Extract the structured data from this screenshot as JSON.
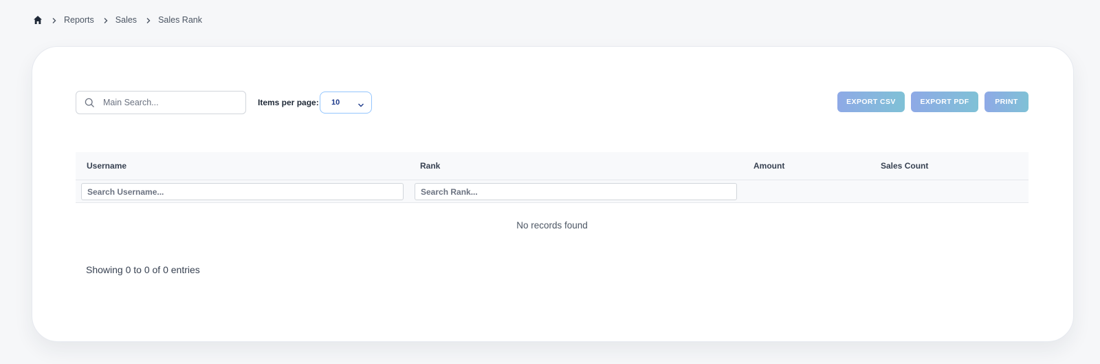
{
  "breadcrumb": {
    "home_icon": "home-icon",
    "items": [
      "Reports",
      "Sales",
      "Sales Rank"
    ]
  },
  "toolbar": {
    "search_placeholder": "Main Search...",
    "items_per_page_label": "Items per page:",
    "items_per_page_value": "10",
    "export_csv": "EXPORT CSV",
    "export_pdf": "EXPORT PDF",
    "print": "PRINT"
  },
  "table": {
    "columns": [
      "Username",
      "Rank",
      "Amount",
      "Sales Count"
    ],
    "filters": {
      "username_placeholder": "Search Username...",
      "rank_placeholder": "Search Rank..."
    },
    "empty_message": "No records found"
  },
  "footer": {
    "showing": "Showing 0 to 0 of 0 entries"
  },
  "colors": {
    "button_gradient_start": "#8ea9e6",
    "button_gradient_end": "#7fc1d6",
    "page_bg": "#f6f7f9"
  }
}
